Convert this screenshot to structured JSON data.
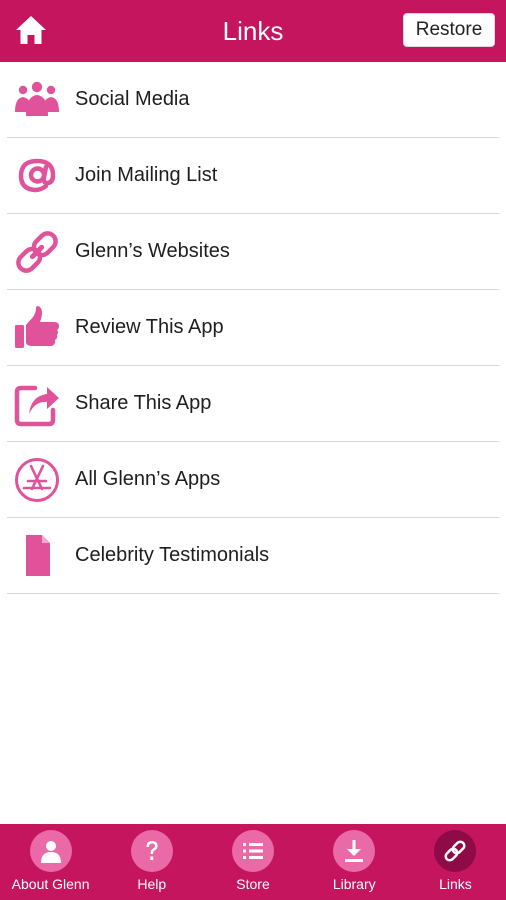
{
  "header": {
    "title": "Links",
    "restore_label": "Restore"
  },
  "items": [
    {
      "label": "Social Media",
      "icon": "people-icon"
    },
    {
      "label": "Join Mailing List",
      "icon": "at-sign-icon"
    },
    {
      "label": "Glenn’s Websites",
      "icon": "chain-link-icon"
    },
    {
      "label": "Review This App",
      "icon": "thumbs-up-icon"
    },
    {
      "label": "Share This App",
      "icon": "share-arrow-icon"
    },
    {
      "label": "All Glenn’s Apps",
      "icon": "app-store-icon"
    },
    {
      "label": "Celebrity Testimonials",
      "icon": "document-icon"
    }
  ],
  "tabs": [
    {
      "label": "About Glenn",
      "icon": "person-icon",
      "active": false
    },
    {
      "label": "Help",
      "icon": "question-mark-icon",
      "active": false
    },
    {
      "label": "Store",
      "icon": "list-icon",
      "active": false
    },
    {
      "label": "Library",
      "icon": "download-icon",
      "active": false
    },
    {
      "label": "Links",
      "icon": "link-icon",
      "active": true
    }
  ],
  "colors": {
    "brand": "#c4155e",
    "icon_pink": "#e0529a",
    "tab_circle": "#ea6aa7",
    "tab_circle_active": "#8e0b48"
  }
}
